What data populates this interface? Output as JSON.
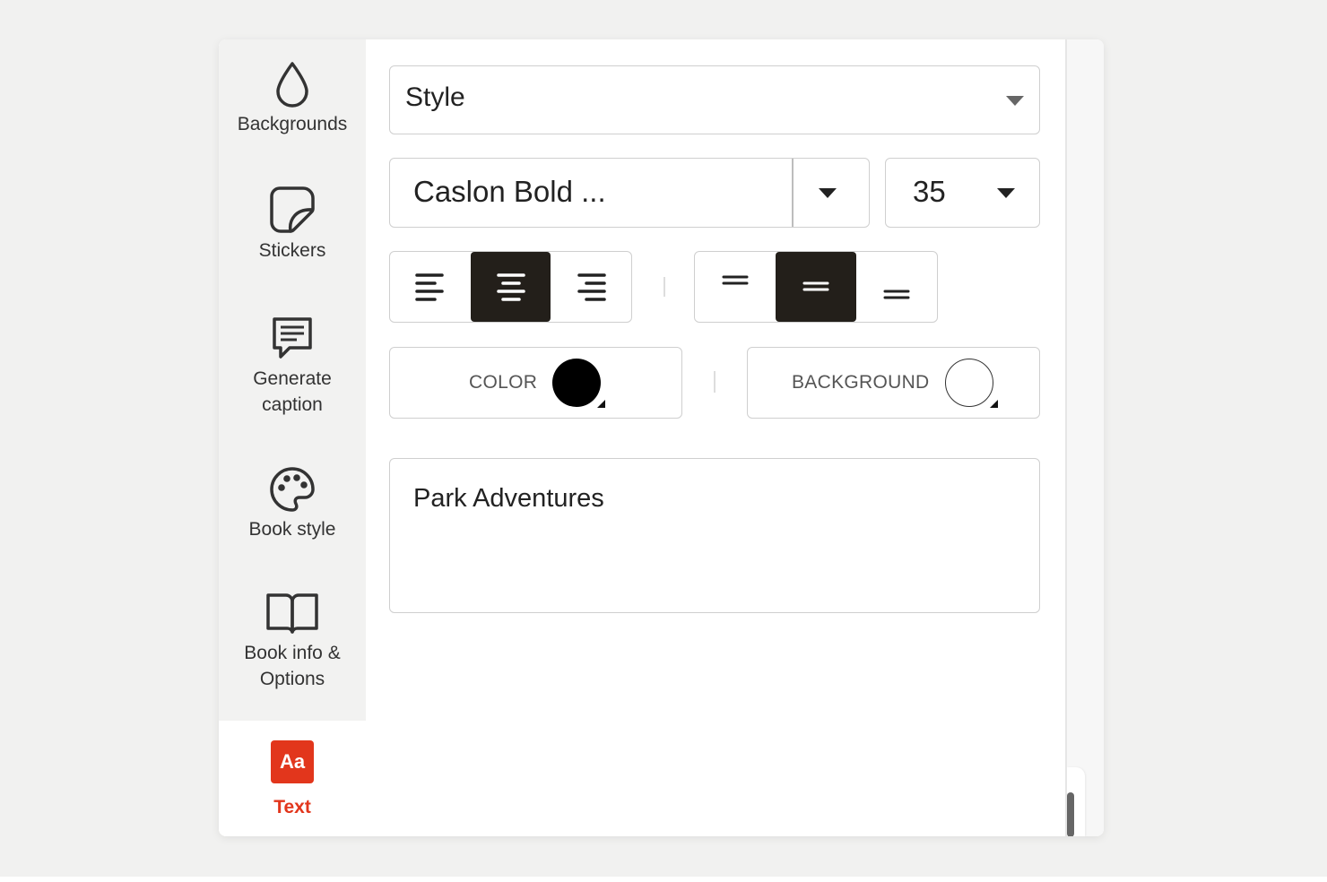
{
  "sidebar": {
    "items": [
      {
        "label": "Backgrounds",
        "icon": "droplet-icon"
      },
      {
        "label": "Stickers",
        "icon": "sticker-icon"
      },
      {
        "label_line1": "Generate",
        "label_line2": "caption",
        "icon": "caption-icon"
      },
      {
        "label": "Book style",
        "icon": "palette-icon"
      },
      {
        "label_line1": "Book info &",
        "label_line2": "Options",
        "icon": "book-icon"
      },
      {
        "label": "Text",
        "icon": "text-aa-icon",
        "icon_text": "Aa",
        "active": true
      }
    ]
  },
  "editor": {
    "style_select": {
      "value": "Style"
    },
    "font_select": {
      "value": "Caslon Bold ..."
    },
    "size_select": {
      "value": "35"
    },
    "alignment": {
      "options": [
        "left",
        "center",
        "right"
      ],
      "selected": "center"
    },
    "vertical_alignment": {
      "options": [
        "top",
        "middle",
        "bottom"
      ],
      "selected": "middle"
    },
    "color": {
      "label": "COLOR",
      "value": "#000000"
    },
    "background": {
      "label": "BACKGROUND",
      "value": "#ffffff"
    },
    "text_value": "Park Adventures"
  },
  "colors": {
    "accent": "#e2361c",
    "active_button": "#231f1a"
  }
}
